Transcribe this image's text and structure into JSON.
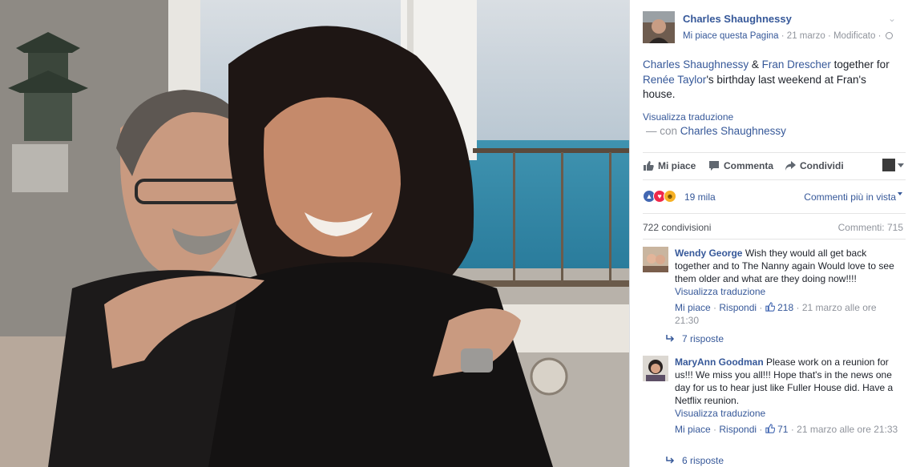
{
  "post": {
    "author": "Charles Shaughnessy",
    "liked_page": "Mi piace questa Pagina",
    "date": "21 marzo",
    "edited": "Modificato",
    "text": {
      "p1": "Charles Shaughnessy",
      "amp": " & ",
      "p2": "Fran Drescher",
      "mid": " together for ",
      "p3": "Renée Taylor",
      "end": "'s birthday last weekend at Fran's house."
    },
    "translate": "Visualizza traduzione",
    "with_prefix": "— con",
    "with_name": "Charles Shaughnessy"
  },
  "actions": {
    "like": "Mi piace",
    "comment": "Commenta",
    "share": "Condividi"
  },
  "stats": {
    "reactions_count": "19 mila",
    "sort_label": "Commenti più in vista",
    "shares": "722 condivisioni",
    "comments": "Commenti: 715"
  },
  "comments": [
    {
      "name": "Wendy George",
      "text": "Wish they would all get back together and to The Nanny again Would love to see them older and what are they doing now!!!!",
      "translate": "Visualizza traduzione",
      "like": "Mi piace",
      "reply": "Rispondi",
      "likes": "218",
      "date": "21 marzo alle ore 21:30",
      "replies": "7 risposte"
    },
    {
      "name": "MaryAnn Goodman",
      "text": "Please work on a reunion for us!!! We miss you all!!! Hope that's in the news one day for us to hear just like Fuller House did. Have a Netflix reunion.",
      "translate": "Visualizza traduzione",
      "like": "Mi piace",
      "reply": "Rispondi",
      "likes": "71",
      "date": "21 marzo alle ore 21:33",
      "replies": "6 risposte"
    }
  ],
  "colors": {
    "link": "#365899",
    "like_blue": "#4267b2",
    "love_red": "#f0284a",
    "haha_yellow": "#f7b125"
  }
}
